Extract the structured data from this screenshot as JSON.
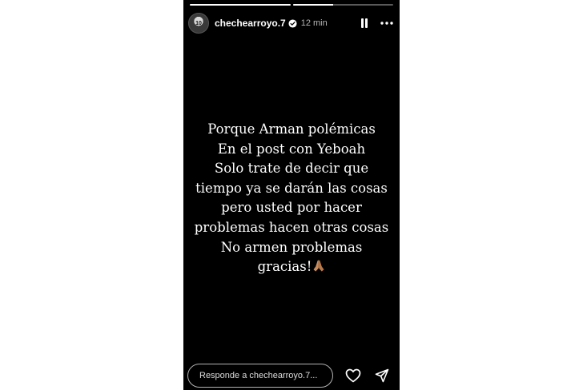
{
  "header": {
    "username": "chechearroyo.7",
    "time": "12 min",
    "avatar_number": "10"
  },
  "progress": [
    {
      "fill_fraction": 1.0
    },
    {
      "fill_fraction": 0.4
    }
  ],
  "story": {
    "lines": [
      "Porque Arman polémicas",
      "En el post con Yeboah",
      "Solo trate de decir que",
      "tiempo ya se darán las cosas",
      "pero usted por hacer",
      "problemas hacen otras cosas",
      "No armen problemas",
      "gracias!"
    ],
    "emoji": "praying-hands"
  },
  "footer": {
    "reply_placeholder": "Responde a chechearroyo.7..."
  },
  "icons": {
    "verified": "verified-badge-icon",
    "pause": "pause-icon",
    "more": "more-options-icon",
    "like": "heart-icon",
    "share": "send-icon"
  },
  "colors": {
    "background": "#000000",
    "text": "#ffffff",
    "emoji": "#c98b5a"
  }
}
